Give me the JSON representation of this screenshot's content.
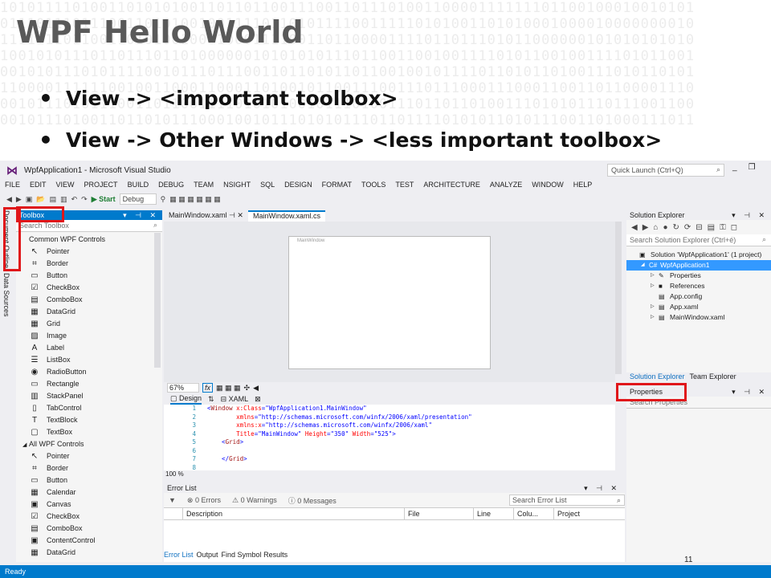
{
  "slide": {
    "title": "WPF Hello World",
    "bullets": [
      "View -> <important toolbox>",
      "View -> Other Windows -> <less important toolbox>"
    ],
    "page_number": "11",
    "binary_rows": [
      "10101111010011010101001101101100111001101110100110000111111101100100010010101",
      "01110111011100110101001001111011010111100111110101001101010001000010000000010",
      "11111110110011010100100010001111001101100001111011011101011000000101010101010",
      "10010101110110111011010000001010101011101100110010011110101100100111101011001",
      "00101011101011110010111011100110110101101100100101111011010110100111010110101",
      "11000011111100100110001100011010010110011100111011100011100011001101100001110",
      "00101110101110011011001111010101001011101001110110110100111010101110111001100",
      "00101110100110110101110001001011101010111011011110101011010111001101000111011"
    ],
    "highlight_color": "#e0161a"
  },
  "vs": {
    "window_title": "WpfApplication1 - Microsoft Visual Studio",
    "quick_launch": "Quick Launch (Ctrl+Q)",
    "menu": [
      "FILE",
      "EDIT",
      "VIEW",
      "PROJECT",
      "BUILD",
      "DEBUG",
      "TEAM",
      "NSIGHT",
      "SQL",
      "DESIGN",
      "FORMAT",
      "TOOLS",
      "TEST",
      "ARCHITECTURE",
      "ANALYZE",
      "WINDOW",
      "HELP"
    ],
    "toolbar": {
      "start": "Start",
      "config": "Debug"
    },
    "left_tabs": {
      "document_outline": "Document Outline",
      "data_sources": "Data Sources"
    },
    "toolbox": {
      "title": "Toolbox",
      "search": "Search Toolbox",
      "groups": [
        {
          "name": "Common WPF Controls",
          "items": [
            {
              "label": "Pointer",
              "icon": "pointer-icon"
            },
            {
              "label": "Border",
              "icon": "border-icon"
            },
            {
              "label": "Button",
              "icon": "button-icon"
            },
            {
              "label": "CheckBox",
              "icon": "checkbox-icon"
            },
            {
              "label": "ComboBox",
              "icon": "combobox-icon"
            },
            {
              "label": "DataGrid",
              "icon": "datagrid-icon"
            },
            {
              "label": "Grid",
              "icon": "grid-icon"
            },
            {
              "label": "Image",
              "icon": "image-icon"
            },
            {
              "label": "Label",
              "icon": "label-icon"
            },
            {
              "label": "ListBox",
              "icon": "listbox-icon"
            },
            {
              "label": "RadioButton",
              "icon": "radiobutton-icon"
            },
            {
              "label": "Rectangle",
              "icon": "rectangle-icon"
            },
            {
              "label": "StackPanel",
              "icon": "stackpanel-icon"
            },
            {
              "label": "TabControl",
              "icon": "tabcontrol-icon"
            },
            {
              "label": "TextBlock",
              "icon": "textblock-icon"
            },
            {
              "label": "TextBox",
              "icon": "textbox-icon"
            }
          ]
        },
        {
          "name": "All WPF Controls",
          "items": [
            {
              "label": "Pointer",
              "icon": "pointer-icon"
            },
            {
              "label": "Border",
              "icon": "border-icon"
            },
            {
              "label": "Button",
              "icon": "button-icon"
            },
            {
              "label": "Calendar",
              "icon": "calendar-icon"
            },
            {
              "label": "Canvas",
              "icon": "canvas-icon"
            },
            {
              "label": "CheckBox",
              "icon": "checkbox-icon"
            },
            {
              "label": "ComboBox",
              "icon": "combobox-icon"
            },
            {
              "label": "ContentControl",
              "icon": "contentcontrol-icon"
            },
            {
              "label": "DataGrid",
              "icon": "datagrid-icon"
            }
          ]
        }
      ]
    },
    "doc_tabs": [
      {
        "label": "MainWindow.xaml",
        "active": false
      },
      {
        "label": "MainWindow.xaml.cs",
        "active": true
      }
    ],
    "designer": {
      "window_caption": "MainWindow",
      "zoom": "67%",
      "fx": "fx"
    },
    "split": {
      "design": "Design",
      "swap": "⇅",
      "xaml": "XAML"
    },
    "code": [
      {
        "n": "1",
        "parts": [
          [
            "tg",
            "<"
          ],
          [
            "kw",
            "Window "
          ],
          [
            "at",
            "x:Class"
          ],
          [
            "tg",
            "="
          ],
          [
            "st",
            "\"WpfApplication1.MainWindow\""
          ]
        ]
      },
      {
        "n": "2",
        "parts": [
          [
            "at",
            "        xmlns"
          ],
          [
            "tg",
            "="
          ],
          [
            "st",
            "\"http://schemas.microsoft.com/winfx/2006/xaml/presentation\""
          ]
        ]
      },
      {
        "n": "3",
        "parts": [
          [
            "at",
            "        xmlns:x"
          ],
          [
            "tg",
            "="
          ],
          [
            "st",
            "\"http://schemas.microsoft.com/winfx/2006/xaml\""
          ]
        ]
      },
      {
        "n": "4",
        "parts": [
          [
            "at",
            "        Title"
          ],
          [
            "tg",
            "="
          ],
          [
            "st",
            "\"MainWindow\""
          ],
          [
            "at",
            " Height"
          ],
          [
            "tg",
            "="
          ],
          [
            "st",
            "\"350\""
          ],
          [
            "at",
            " Width"
          ],
          [
            "tg",
            "="
          ],
          [
            "st",
            "\"525\""
          ],
          [
            "tg",
            ">"
          ]
        ]
      },
      {
        "n": "5",
        "parts": [
          [
            "tg",
            "    <"
          ],
          [
            "kw",
            "Grid"
          ],
          [
            "tg",
            ">"
          ]
        ]
      },
      {
        "n": "6",
        "parts": [
          [
            "tg",
            ""
          ]
        ]
      },
      {
        "n": "7",
        "parts": [
          [
            "tg",
            "    </"
          ],
          [
            "kw",
            "Grid"
          ],
          [
            "tg",
            ">"
          ]
        ]
      },
      {
        "n": "8",
        "parts": [
          [
            "tg",
            ""
          ]
        ]
      }
    ],
    "code_zoom": "100 %",
    "error_list": {
      "title": "Error List",
      "errors": "0 Errors",
      "warnings": "0 Warnings",
      "messages": "0 Messages",
      "search": "Search Error List",
      "columns": [
        "Description",
        "File",
        "Line",
        "Colu...",
        "Project"
      ]
    },
    "bottom_tabs": [
      "Error List",
      "Output",
      "Find Symbol Results"
    ],
    "solution_explorer": {
      "title": "Solution Explorer",
      "search": "Search Solution Explorer (Ctrl+é)",
      "nodes": [
        {
          "label": "Solution 'WpfApplication1' (1 project)",
          "icon": "solution-icon",
          "level": 0,
          "tri": ""
        },
        {
          "label": "WpfApplication1",
          "icon": "csharp-project-icon",
          "level": 1,
          "tri": "◢",
          "sel": true
        },
        {
          "label": "Properties",
          "icon": "wrench-icon",
          "level": 2,
          "tri": "▷"
        },
        {
          "label": "References",
          "icon": "references-icon",
          "level": 2,
          "tri": "▷"
        },
        {
          "label": "App.config",
          "icon": "config-file-icon",
          "level": 2,
          "tri": ""
        },
        {
          "label": "App.xaml",
          "icon": "xaml-file-icon",
          "level": 2,
          "tri": "▷"
        },
        {
          "label": "MainWindow.xaml",
          "icon": "xaml-file-icon",
          "level": 2,
          "tri": "▷"
        }
      ],
      "tabs": [
        "Solution Explorer",
        "Team Explorer"
      ]
    },
    "properties": {
      "title": "Properties",
      "search": "Search Properties"
    },
    "status": "Ready",
    "accent": "#007acc"
  }
}
